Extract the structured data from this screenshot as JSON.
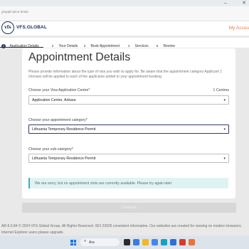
{
  "browser": {
    "url": "g/application-detail"
  },
  "header": {
    "logo_mark": "vfs",
    "logo_text": "VFS.GLOBAL",
    "my_account": "My Accou"
  },
  "steps": [
    {
      "number": "1",
      "label": "Application Details",
      "active": true
    },
    {
      "number": "2",
      "label": "Your Details",
      "active": false
    },
    {
      "number": "3",
      "label": "Book Appointment",
      "active": false
    },
    {
      "number": "4",
      "label": "Services",
      "active": false
    },
    {
      "number": "5",
      "label": "Review",
      "active": false
    }
  ],
  "form": {
    "title": "Appointment Details",
    "intro": "Please provide information about the type of visa you wish to apply for. Be aware that the appointment category Applicant 1 chooses will be applied to each of the applicants added to your appointment booking.",
    "centre": {
      "label": "Choose your Visa Application Centre*",
      "count": "1 Centres",
      "value": "Application Centre, Ankara"
    },
    "category": {
      "label": "Choose your appointment category*",
      "value": "Lithuania Temporary Residence Permit"
    },
    "subcategory": {
      "label": "Choose your sub-category*",
      "value": "Lithuania Temporary Residence Permit"
    },
    "alert": "We are sorry, but no appointment slots are currently available. Please try again later",
    "continue_label": "Continue"
  },
  "footer": {
    "text": "AR-6.0.84 © 2024 VFS Global Group. All Rights Reserved. ISO 23026 consistent information. Our websites are created for viewing on modern browsers; Internet Explorer users please upgrade."
  },
  "taskbar": {
    "search_placeholder": "Ara",
    "apps": [
      {
        "name": "task-view-icon",
        "color": "#2b2b2b"
      },
      {
        "name": "widgets-icon",
        "color": "#3b7ddd"
      },
      {
        "name": "file-explorer-icon",
        "color": "#f2b824"
      },
      {
        "name": "chrome-icon",
        "color": "#4285f4"
      },
      {
        "name": "edge-icon",
        "color": "#17a2b8"
      },
      {
        "name": "store-icon",
        "color": "#2f6fd6"
      },
      {
        "name": "app-icon-red",
        "color": "#d93a2b"
      },
      {
        "name": "app-icon-orange",
        "color": "#e8743b"
      }
    ]
  },
  "colors": {
    "brand_navy": "#1c2f57",
    "accent_orange": "#e9784a",
    "alert_teal": "#35b6b9",
    "alert_bg": "#dff3f4",
    "disabled_button": "#d7d7d7"
  }
}
